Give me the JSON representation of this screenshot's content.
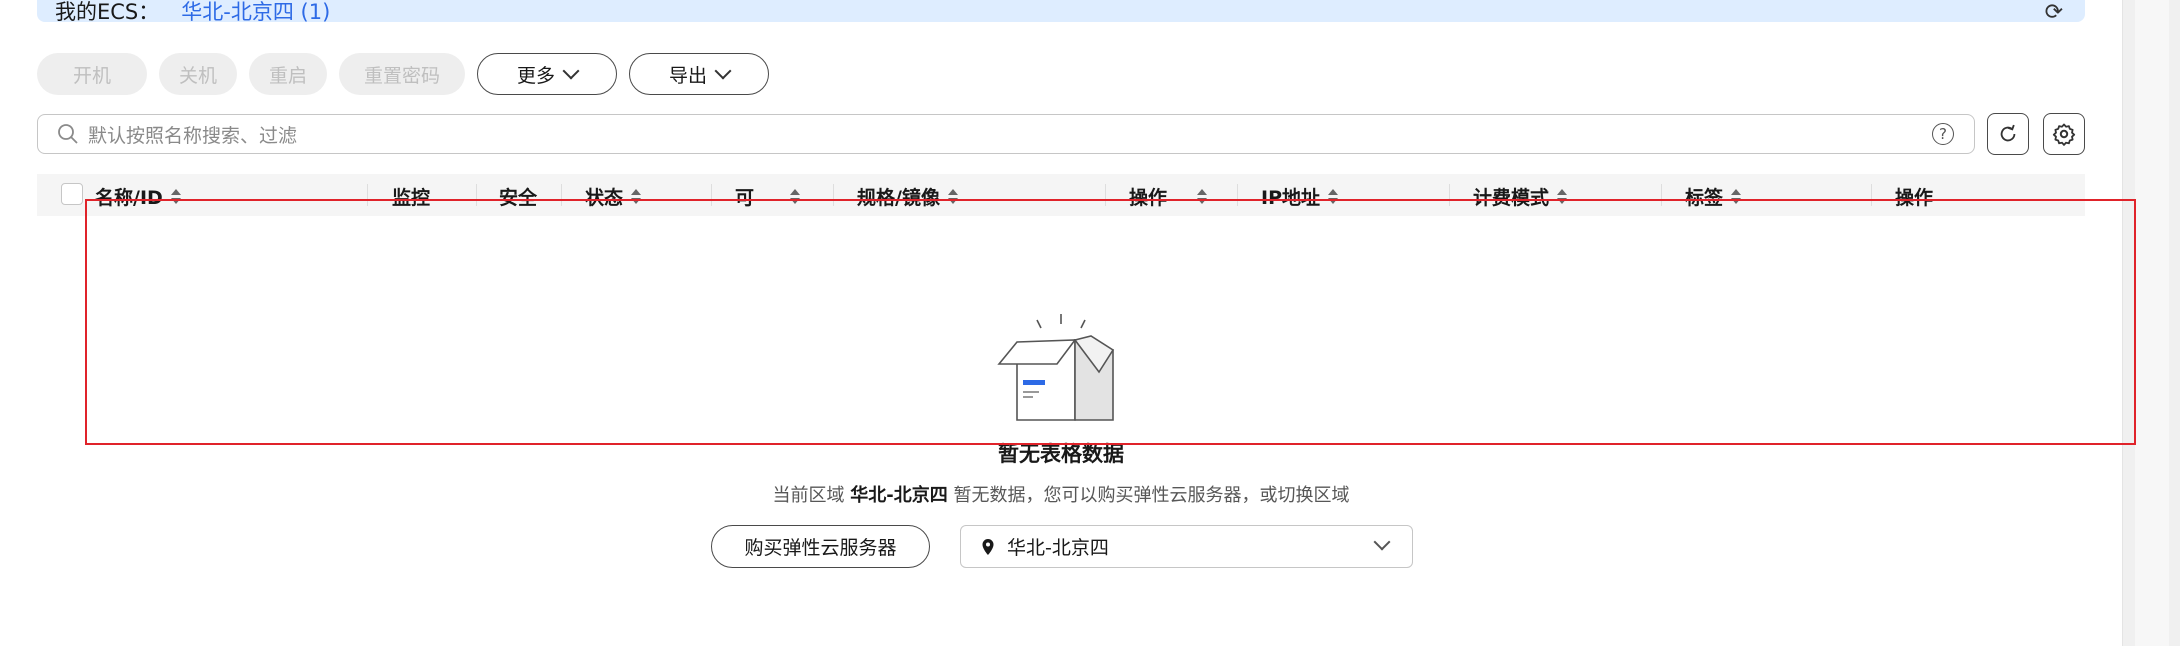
{
  "notice": {
    "label": "我的ECS：",
    "value": "华北-北京四 (1)"
  },
  "toolbar": {
    "buttons": [
      {
        "label": "开机",
        "state": "disabled"
      },
      {
        "label": "关机",
        "state": "disabled"
      },
      {
        "label": "重启",
        "state": "disabled"
      },
      {
        "label": "重置密码",
        "state": "disabled"
      },
      {
        "label": "更多",
        "state": "enabled",
        "icon": "chevron-down-icon"
      },
      {
        "label": "导出",
        "state": "enabled",
        "icon": "chevron-down-icon"
      }
    ]
  },
  "search": {
    "placeholder": "默认按照名称搜索、过滤",
    "help_icon": "?"
  },
  "table": {
    "columns": [
      {
        "label": "名称/ID",
        "sortable": true
      },
      {
        "label": "监控",
        "sortable": false
      },
      {
        "label": "安全",
        "sortable": false
      },
      {
        "label": "状态",
        "sortable": true
      },
      {
        "label": "可",
        "sortable": true
      },
      {
        "label": "规格/镜像",
        "sortable": true
      },
      {
        "label": "操作",
        "sortable": true
      },
      {
        "label": "IP地址",
        "sortable": true
      },
      {
        "label": "计费模式",
        "sortable": true
      },
      {
        "label": "标签",
        "sortable": true
      },
      {
        "label": "操作",
        "sortable": false
      }
    ]
  },
  "empty": {
    "title": "暂无表格数据",
    "desc_prefix": "当前区域",
    "desc_region": "华北-北京四",
    "desc_suffix": "暂无数据，您可以购买弹性云服务器，或切换区域",
    "buy_button": "购买弹性云服务器",
    "region_value": "华北-北京四"
  },
  "colors": {
    "accent": "#2d6ae6",
    "highlight_border": "#e0232a",
    "notice_bg": "#deedff"
  }
}
